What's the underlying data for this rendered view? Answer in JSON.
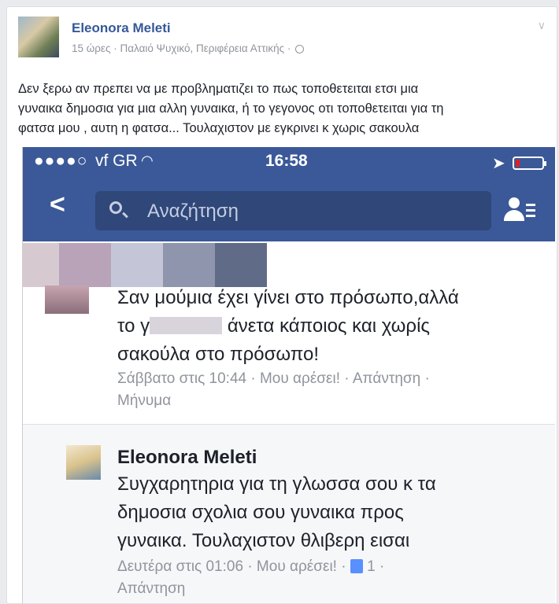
{
  "post": {
    "author": "Eleonora Meleti",
    "meta": "15 ώρες · Παλαιό Ψυχικό, Περιφέρεια Αττικής ·",
    "text_lines": [
      "Δεν ξερω αν πρεπει να με προβληματιζει το πως τοποθετειται ετσι μια",
      "γυναικα δημοσια για μια αλλη γυναικα, ή το γεγονος οτι τοποθετειται για τη",
      "φατσα μου , αυτη η φατσα... Τουλαχιστον με εγκρινει κ χωρις σακουλα"
    ]
  },
  "screenshot": {
    "status": {
      "dots": "●●●●○",
      "carrier": "vf GR",
      "time": "16:58"
    },
    "search_placeholder": "Αναζήτηση",
    "comment1": {
      "lines": [
        "Σαν μούμια έχει γίνει στο πρόσωπο,αλλά",
        "άνετα κάποιος και χωρίς",
        "σακούλα στο πρόσωπο!"
      ],
      "line2_prefix": "το γ",
      "meta_line1": "Σάββατο στις 10:44 · Μου αρέσει! · Απάντηση ·",
      "meta_line2": "Μήνυμα"
    },
    "comment2": {
      "name": "Eleonora Meleti",
      "lines": [
        "Συγχαρητηρια για τη γλωσσα σου κ τα",
        "δημοσια σχολια σου γυναικα προς",
        "γυναικα. Τουλαχιστον θλιβερη εισαι"
      ],
      "meta_time": "Δευτέρα στις 01:06 · Μου αρέσει! ·",
      "likes": "1 ·",
      "meta_line2": "Απάντηση"
    }
  },
  "colors": {
    "fb_blue": "#3b5998",
    "link": "#365899"
  }
}
